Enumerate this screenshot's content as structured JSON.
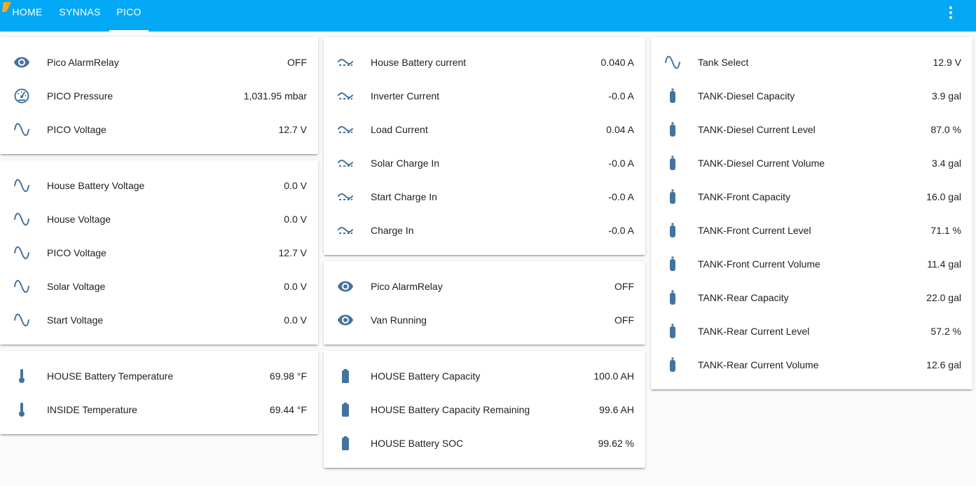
{
  "header": {
    "tabs": [
      {
        "label": "HOME"
      },
      {
        "label": "SYNNAS"
      },
      {
        "label": "PICO"
      }
    ],
    "active_tab": "PICO",
    "colors": {
      "accent": "#03a9f4",
      "icon": "#44739e"
    }
  },
  "columns": [
    {
      "cards": [
        {
          "rows": [
            {
              "icon": "eye-icon",
              "name": "Pico AlarmRelay",
              "value": "OFF"
            },
            {
              "icon": "gauge-icon",
              "name": "PICO Pressure",
              "value": "1,031.95 mbar"
            },
            {
              "icon": "sine-wave-icon",
              "name": "PICO Voltage",
              "value": "12.7 V"
            }
          ]
        },
        {
          "rows": [
            {
              "icon": "sine-wave-icon",
              "name": "House Battery Voltage",
              "value": "0.0 V"
            },
            {
              "icon": "sine-wave-icon",
              "name": "House Voltage",
              "value": "0.0 V"
            },
            {
              "icon": "sine-wave-icon",
              "name": "PICO Voltage",
              "value": "12.7 V"
            },
            {
              "icon": "sine-wave-icon",
              "name": "Solar Voltage",
              "value": "0.0 V"
            },
            {
              "icon": "sine-wave-icon",
              "name": "Start Voltage",
              "value": "0.0 V"
            }
          ]
        },
        {
          "rows": [
            {
              "icon": "thermometer-icon",
              "name": "HOUSE Battery Temperature",
              "value": "69.98 °F"
            },
            {
              "icon": "thermometer-icon",
              "name": "INSIDE Temperature",
              "value": "69.44 °F"
            }
          ]
        }
      ]
    },
    {
      "cards": [
        {
          "rows": [
            {
              "icon": "current-ac-icon",
              "name": "House Battery current",
              "value": "0.040 A"
            },
            {
              "icon": "current-ac-icon",
              "name": "Inverter Current",
              "value": "-0.0 A"
            },
            {
              "icon": "current-ac-icon",
              "name": "Load Current",
              "value": "0.04 A"
            },
            {
              "icon": "current-ac-icon",
              "name": "Solar Charge In",
              "value": "-0.0 A"
            },
            {
              "icon": "current-ac-icon",
              "name": "Start Charge In",
              "value": "-0.0 A"
            },
            {
              "icon": "current-ac-icon",
              "name": "Charge In",
              "value": "-0.0 A"
            }
          ]
        },
        {
          "rows": [
            {
              "icon": "eye-icon",
              "name": "Pico AlarmRelay",
              "value": "OFF"
            },
            {
              "icon": "eye-icon",
              "name": "Van Running",
              "value": "OFF"
            }
          ]
        },
        {
          "rows": [
            {
              "icon": "battery-icon",
              "name": "HOUSE Battery Capacity",
              "value": "100.0 AH"
            },
            {
              "icon": "battery-icon",
              "name": "HOUSE Battery Capacity Remaining",
              "value": "99.6 AH"
            },
            {
              "icon": "battery-icon",
              "name": "HOUSE Battery SOC",
              "value": "99.62 %"
            }
          ]
        }
      ]
    },
    {
      "cards": [
        {
          "rows": [
            {
              "icon": "sine-wave-icon",
              "name": "Tank Select",
              "value": "12.9 V"
            },
            {
              "icon": "gas-cylinder-icon",
              "name": "TANK-Diesel Capacity",
              "value": "3.9 gal"
            },
            {
              "icon": "gas-cylinder-icon",
              "name": "TANK-Diesel Current Level",
              "value": "87.0 %"
            },
            {
              "icon": "gas-cylinder-icon",
              "name": "TANK-Diesel Current Volume",
              "value": "3.4 gal"
            },
            {
              "icon": "gas-cylinder-icon",
              "name": "TANK-Front Capacity",
              "value": "16.0 gal"
            },
            {
              "icon": "gas-cylinder-icon",
              "name": "TANK-Front Current Level",
              "value": "71.1 %"
            },
            {
              "icon": "gas-cylinder-icon",
              "name": "TANK-Front Current Volume",
              "value": "11.4 gal"
            },
            {
              "icon": "gas-cylinder-icon",
              "name": "TANK-Rear Capacity",
              "value": "22.0 gal"
            },
            {
              "icon": "gas-cylinder-icon",
              "name": "TANK-Rear Current Level",
              "value": "57.2 %"
            },
            {
              "icon": "gas-cylinder-icon",
              "name": "TANK-Rear Current Volume",
              "value": "12.6 gal"
            }
          ]
        }
      ]
    }
  ]
}
